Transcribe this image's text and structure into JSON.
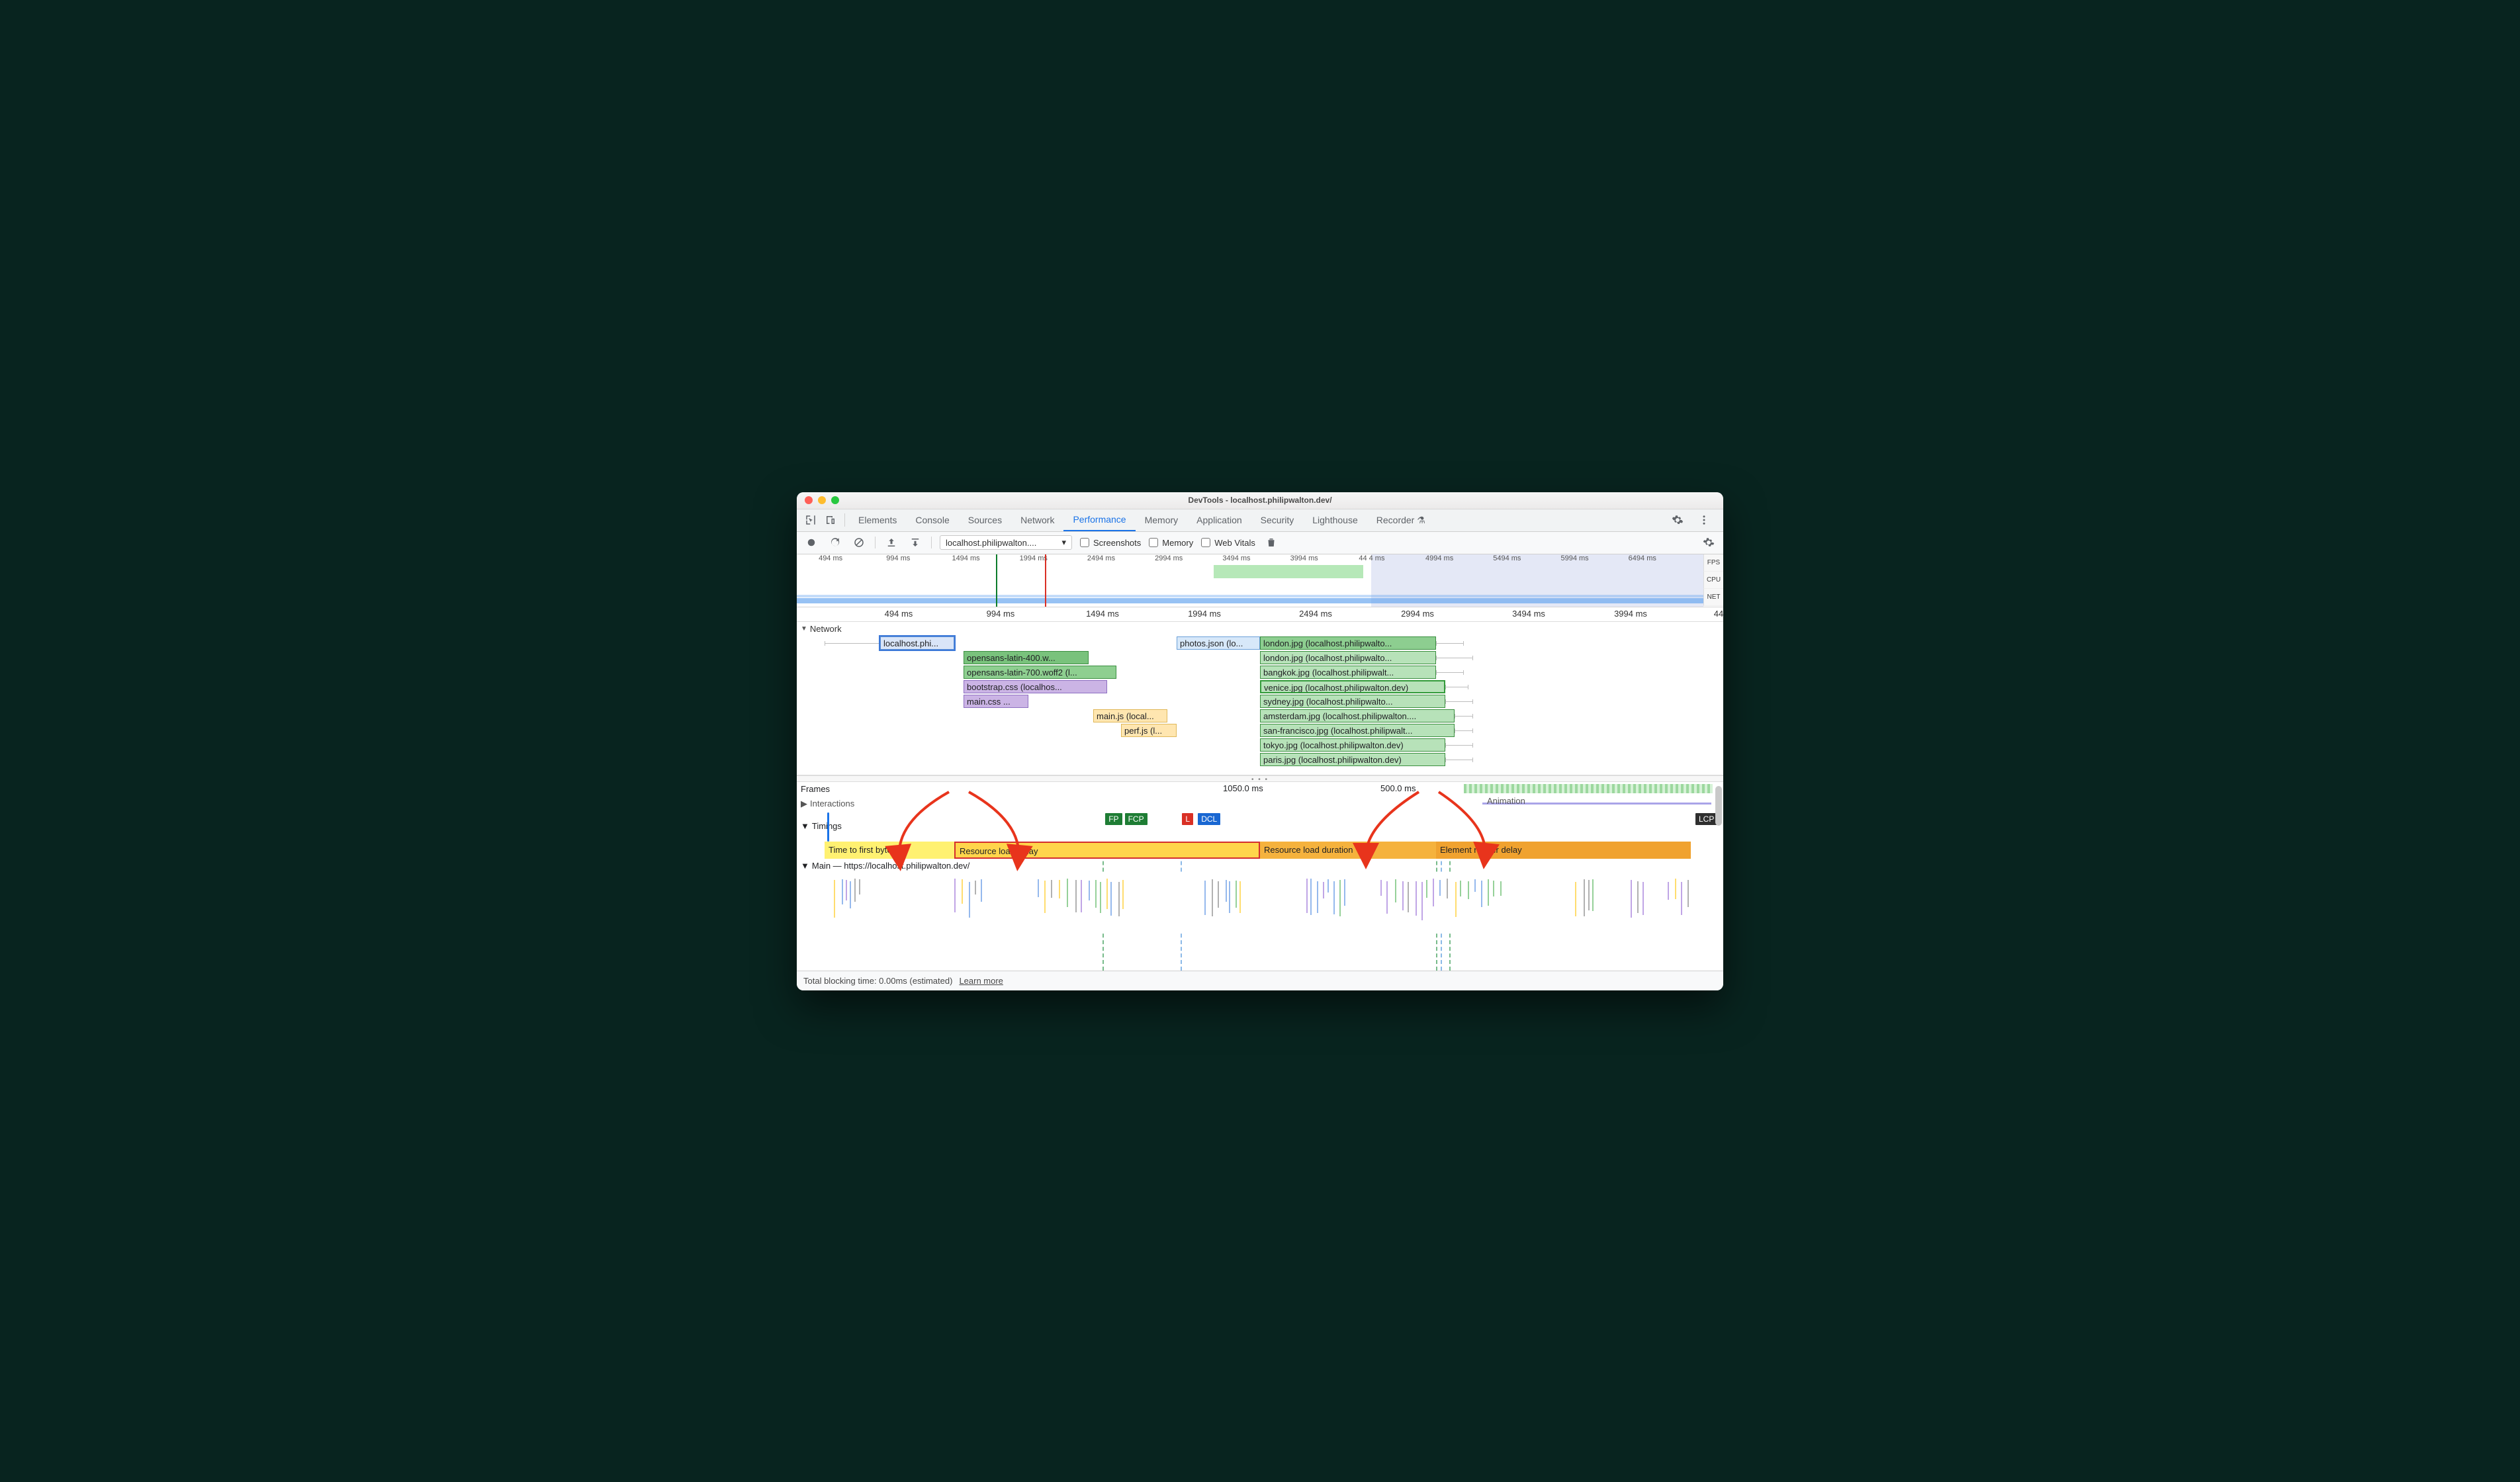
{
  "window": {
    "title": "DevTools - localhost.philipwalton.dev/"
  },
  "tabs": {
    "items": [
      "Elements",
      "Console",
      "Sources",
      "Network",
      "Performance",
      "Memory",
      "Application",
      "Security",
      "Lighthouse",
      "Recorder"
    ],
    "active": "Performance",
    "recorder_badge": "⚗"
  },
  "toolbar": {
    "profile_select": "localhost.philipwalton....",
    "checkboxes": {
      "screenshots": "Screenshots",
      "memory": "Memory",
      "web_vitals": "Web Vitals"
    }
  },
  "overview": {
    "ticks": [
      "494 ms",
      "994 ms",
      "1494 ms",
      "1994 ms",
      "2494 ms",
      "2994 ms",
      "3494 ms",
      "3994 ms",
      "44 4 ms",
      "4994 ms",
      "5494 ms",
      "5994 ms",
      "6494 ms"
    ],
    "side": [
      "FPS",
      "CPU",
      "NET"
    ],
    "selection": {
      "start_pct": 0,
      "end_pct": 62
    },
    "markers": {
      "green_pct": 21.5,
      "red_pct": 26.8
    },
    "green_block": {
      "start_pct": 46,
      "end_pct": 62.5
    }
  },
  "ruler2": {
    "ticks": [
      {
        "label": "494 ms",
        "pct": 11
      },
      {
        "label": "994 ms",
        "pct": 22
      },
      {
        "label": "1494 ms",
        "pct": 33
      },
      {
        "label": "1994 ms",
        "pct": 44
      },
      {
        "label": "2494 ms",
        "pct": 56
      },
      {
        "label": "2994 ms",
        "pct": 67
      },
      {
        "label": "3494 ms",
        "pct": 79
      },
      {
        "label": "3994 ms",
        "pct": 90
      },
      {
        "label": "44",
        "pct": 99.5
      }
    ]
  },
  "network": {
    "label": "Network",
    "rows": [
      {
        "label": "localhost.phi...",
        "row": 0,
        "start": 9,
        "end": 17,
        "whisk_start": 3,
        "bg": "#d9e5f8",
        "bd": "#5b8fd6",
        "sel": true
      },
      {
        "label": "opensans-latin-400.w...",
        "row": 1,
        "start": 18,
        "end": 31.5,
        "bg": "#79c27c",
        "bd": "#3b8f40"
      },
      {
        "label": "opensans-latin-700.woff2 (l...",
        "row": 2,
        "start": 18,
        "end": 34.5,
        "bg": "#8ecf90",
        "bd": "#3b8f40"
      },
      {
        "label": "bootstrap.css (localhos...",
        "row": 3,
        "start": 18,
        "end": 33.5,
        "bg": "#cbb4e5",
        "bd": "#8d6ec1"
      },
      {
        "label": "main.css ...",
        "row": 4,
        "start": 18,
        "end": 25,
        "bg": "#cbb4e5",
        "bd": "#8d6ec1"
      },
      {
        "label": "main.js (local...",
        "row": 5,
        "start": 32,
        "end": 40,
        "bg": "#ffe6b0",
        "bd": "#e0b85a"
      },
      {
        "label": "perf.js (l...",
        "row": 6,
        "start": 35,
        "end": 41,
        "bg": "#ffe6b0",
        "bd": "#e0b85a"
      },
      {
        "label": "photos.json (lo...",
        "row": 0,
        "start": 41,
        "end": 50,
        "bg": "#d7e8f9",
        "bd": "#6aa0d8"
      },
      {
        "label": "london.jpg (localhost.philipwalto...",
        "row": 0,
        "start": 50,
        "end": 69,
        "whisk_end": 72,
        "bg": "#8dce90",
        "bd": "#3b8f40"
      },
      {
        "label": "london.jpg (localhost.philipwalto...",
        "row": 1,
        "start": 50,
        "end": 69,
        "whisk_end": 73,
        "bg": "#b7e2b9",
        "bd": "#3b8f40"
      },
      {
        "label": "bangkok.jpg (localhost.philipwalt...",
        "row": 2,
        "start": 50,
        "end": 69,
        "whisk_end": 72,
        "bg": "#b7e2b9",
        "bd": "#3b8f40"
      },
      {
        "label": "venice.jpg (localhost.philipwalton.dev)",
        "row": 3,
        "start": 50,
        "end": 70,
        "whisk_end": 72.5,
        "bg": "#b7e2b9",
        "bd": "#329b3a",
        "strong": true
      },
      {
        "label": "sydney.jpg (localhost.philipwalto...",
        "row": 4,
        "start": 50,
        "end": 70,
        "whisk_end": 73,
        "bg": "#b7e2b9",
        "bd": "#3b8f40"
      },
      {
        "label": "amsterdam.jpg (localhost.philipwalton....",
        "row": 5,
        "start": 50,
        "end": 71,
        "whisk_end": 73,
        "bg": "#b7e2b9",
        "bd": "#3b8f40"
      },
      {
        "label": "san-francisco.jpg (localhost.philipwalt...",
        "row": 6,
        "start": 50,
        "end": 71,
        "whisk_end": 73,
        "bg": "#b7e2b9",
        "bd": "#3b8f40"
      },
      {
        "label": "tokyo.jpg (localhost.philipwalton.dev)",
        "row": 7,
        "start": 50,
        "end": 70,
        "whisk_end": 73,
        "bg": "#b7e2b9",
        "bd": "#3b8f40"
      },
      {
        "label": "paris.jpg (localhost.philipwalton.dev)",
        "row": 8,
        "start": 50,
        "end": 70,
        "whisk_end": 73,
        "bg": "#b7e2b9",
        "bd": "#3b8f40"
      }
    ]
  },
  "flame": {
    "frames_label": "Frames",
    "frame_values": [
      {
        "text": "1050.0 ms",
        "pct": 46
      },
      {
        "text": "500.0 ms",
        "pct": 63
      }
    ],
    "interactions_label": "Interactions",
    "timings_label": "Timings",
    "animation_label": "Animation",
    "markers": [
      {
        "txt": "FP",
        "pct": 33.3,
        "bg": "#1e7d34"
      },
      {
        "txt": "FCP",
        "pct": 35.4,
        "bg": "#1e7d34"
      },
      {
        "txt": "L",
        "pct": 41.6,
        "bg": "#d93025"
      },
      {
        "txt": "DCL",
        "pct": 43.3,
        "bg": "#1967d2"
      },
      {
        "txt": "LCP",
        "pct": 97,
        "bg": "#2f2f2f"
      }
    ],
    "segments": {
      "ttfb": {
        "label": "Time to first byte",
        "start": 3,
        "end": 17
      },
      "rld": {
        "label": "Resource load delay",
        "start": 17,
        "end": 50
      },
      "rdur": {
        "label": "Resource load duration",
        "start": 50,
        "end": 69
      },
      "erd": {
        "label": "Element render delay",
        "start": 69,
        "end": 96.5
      }
    },
    "main_label": "Main — https://localhost.philipwalton.dev/",
    "vdash": [
      {
        "pct": 33.0,
        "cls": "green"
      },
      {
        "pct": 41.4,
        "cls": ""
      },
      {
        "pct": 69.0,
        "cls": "green"
      },
      {
        "pct": 69.5,
        "cls": ""
      },
      {
        "pct": 70.4,
        "cls": "green"
      }
    ]
  },
  "footer": {
    "text": "Total blocking time: 0.00ms (estimated)",
    "link": "Learn more"
  }
}
